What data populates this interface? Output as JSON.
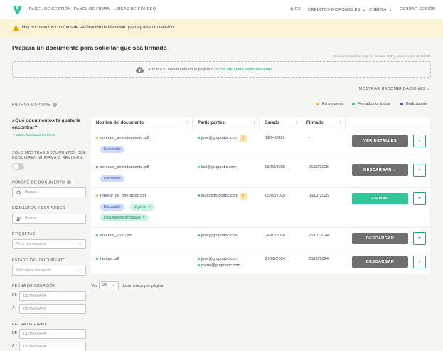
{
  "nav": {
    "language": "ES",
    "links": [
      "PANEL DE GESTIÓN",
      "PANEL DE FIRMA",
      "LÍNEAS DE FONDEO"
    ],
    "credits": "CRÉDITOS DISPONIBLES",
    "account": "CUENTA",
    "logout": "CERRAR SESIÓN"
  },
  "banner": {
    "text": "Hay documentos con fotos de verificación de identidad que requieren tu revisión."
  },
  "upload": {
    "title": "Prepara un documento para solicitar que sea firmado",
    "hint": "El documento debe estar en formato PDF y pesar menos de 30 MB",
    "drop_text": "Arrastra tu documento en la página o ",
    "drop_link": "da clic aquí para seleccionar uno"
  },
  "recommendations": "MOSTRAR RECOMENDACIONES",
  "filters": {
    "quick_label": "FILTROS RÁPIDOS",
    "legend": [
      {
        "label": "En progreso",
        "color": "#f2b632"
      },
      {
        "label": "Firmado por todos",
        "color": "#2fc79a"
      },
      {
        "label": "Endosables",
        "color": "#2f5fd0"
      }
    ],
    "question": "¿Qué documentos te gustaría encontrar?",
    "howto": "Cómo funcionan los filtros",
    "only_mine": "SÓLO MOSTRAR DOCUMENTOS QUE REQUIEREN MI FIRMA O REVISIÓN",
    "doc_name_label": "NOMBRE DE DOCUMENTO",
    "doc_name_placeholder": "Buscar...",
    "signers_label": "FIRMANTES Y REVISORES",
    "signers_placeholder": "Buscar...",
    "tags_label": "ETIQUETAS",
    "tags_placeholder": "Filtrar por etiquetas",
    "status_label": "ESTADO DEL DOCUMENTO",
    "status_placeholder": "Selecciona una opción",
    "created_label": "FECHA DE CREACIÓN",
    "signed_label": "FECHA DE FIRMA",
    "from": "DE",
    "to": "A",
    "date_placeholder": "DD/MM/AAAA"
  },
  "table": {
    "headers": [
      "Nombre del documento",
      "Participantes",
      "Creado",
      "Firmado"
    ],
    "rows": [
      {
        "name": "contrato_arrendamiento.pdf",
        "dot": "#f2b632",
        "participants": [
          "jose@grupoabc.com"
        ],
        "warn": true,
        "created": "11/04/2025",
        "signed": "-",
        "tags": [
          [
            "Endosable",
            "blue",
            false
          ]
        ],
        "action": "VER DETALLES",
        "action_style": "grey"
      },
      {
        "name": "contrato_arrendamiento.pdf",
        "dot": "#2f5fd0",
        "participants": [
          "luis@grupoabc.com"
        ],
        "warn": false,
        "created": "05/02/2025",
        "signed": "06/02/2025",
        "tags": [
          [
            "Endosable",
            "blue",
            false
          ]
        ],
        "action": "DESCARGAR ⌄",
        "action_style": "grey"
      },
      {
        "name": "reporte_de_operación.pdf",
        "dot": "#f2b632",
        "participants": [
          "juan@grupoabc.com"
        ],
        "warn": true,
        "created": "05/02/2025",
        "signed": "06/02/2025",
        "tags": [
          [
            "Endosable",
            "blue",
            false
          ],
          [
            "Urgente",
            "green",
            true
          ],
          [
            "Documentos de trabajo",
            "green",
            true
          ]
        ],
        "action": "FIRMAR",
        "action_style": "green"
      },
      {
        "name": "contrato_2026.pdf",
        "dot": "#2fc79a",
        "participants": [
          "jose@grupoabc.com"
        ],
        "warn": false,
        "created": "24/07/2024",
        "signed": "25/07/2024",
        "tags": [],
        "action": "DESCARGAR",
        "action_style": "grey"
      },
      {
        "name": "factura.pdf",
        "dot": "#2fc79a",
        "participants": [
          "jose@grupoabc.com",
          "maria@grupoabc.com"
        ],
        "warn": false,
        "created": "27/05/2024",
        "signed": "28/05/2024",
        "tags": [],
        "action": "DESCARGAR",
        "action_style": "grey"
      }
    ]
  },
  "pagination": {
    "prefix": "Ver",
    "value": "25",
    "suffix": "documentos por página"
  }
}
